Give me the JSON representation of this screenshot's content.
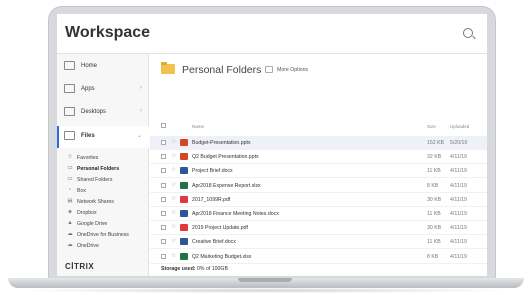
{
  "app": {
    "title": "Workspace"
  },
  "sidebar": {
    "nav": [
      {
        "label": "Home",
        "chevron": ""
      },
      {
        "label": "Apps",
        "chevron": "›"
      },
      {
        "label": "Desktops",
        "chevron": "›"
      },
      {
        "label": "Files",
        "chevron": "⌄"
      }
    ],
    "sub": [
      {
        "label": "Favorites",
        "icon": "☆"
      },
      {
        "label": "Personal Folders",
        "icon": "▭"
      },
      {
        "label": "Shared Folders",
        "icon": "▭"
      },
      {
        "label": "Box",
        "icon": "▫"
      },
      {
        "label": "Network Shares",
        "icon": "▤"
      },
      {
        "label": "Dropbox",
        "icon": "◈"
      },
      {
        "label": "Google Drive",
        "icon": "▲"
      },
      {
        "label": "OneDrive for Business",
        "icon": "☁"
      },
      {
        "label": "OneDrive",
        "icon": "☁"
      }
    ],
    "logo": "CİTRIX"
  },
  "main": {
    "title": "Personal Folders",
    "more_options": "More Options",
    "columns": {
      "name": "Name",
      "size": "Size",
      "uploaded": "Uploaded"
    },
    "files": [
      {
        "name": "Budget-Presentation.pptx",
        "size": "152 KB",
        "date": "5/20/19",
        "type": "ppt",
        "color": "#d24726"
      },
      {
        "name": "Q2 Budget Presentation.pptx",
        "size": "32 KB",
        "date": "4/11/19",
        "type": "ppt",
        "color": "#d24726"
      },
      {
        "name": "Project Brief.docx",
        "size": "11 KB",
        "date": "4/11/19",
        "type": "doc",
        "color": "#2b579a"
      },
      {
        "name": "Apr2018 Expense Report.xlsx",
        "size": "8 KB",
        "date": "4/11/19",
        "type": "xls",
        "color": "#217346"
      },
      {
        "name": "2017_1099R.pdf",
        "size": "30 KB",
        "date": "4/11/19",
        "type": "pdf",
        "color": "#e0393e"
      },
      {
        "name": "Apr2018 Finance Meeting Notes.docx",
        "size": "11 KB",
        "date": "4/11/19",
        "type": "doc",
        "color": "#2b579a"
      },
      {
        "name": "2019 Project Update.pdf",
        "size": "30 KB",
        "date": "4/11/19",
        "type": "pdf",
        "color": "#e0393e"
      },
      {
        "name": "Creative Brief.docx",
        "size": "11 KB",
        "date": "4/11/19",
        "type": "doc",
        "color": "#2b579a"
      },
      {
        "name": "Q2 Marketing Budget.xlsx",
        "size": "8 KB",
        "date": "4/11/19",
        "type": "xls",
        "color": "#217346"
      }
    ],
    "storage_label": "Storage used:",
    "storage_value": "0% of 100GB"
  }
}
